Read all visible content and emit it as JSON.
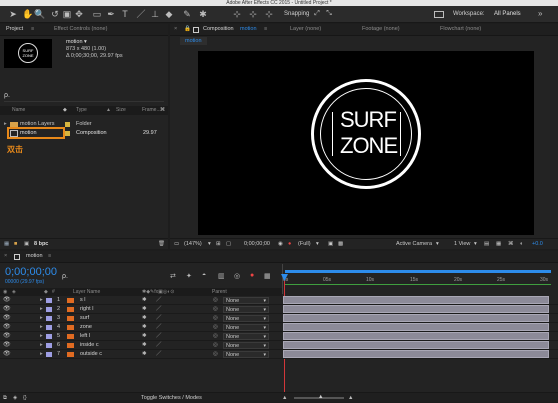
{
  "window": {
    "title": "Adobe After Effects CC 2015 - Untitled Project *"
  },
  "toolbar": {
    "snapping_label": "Snapping",
    "workspace_label": "Workspace:",
    "workspace_value": "All Panels"
  },
  "project_panel": {
    "tab_project": "Project",
    "tab_effects": "Effect Controls (none)",
    "thumbnail_text_line1": "SURF",
    "thumbnail_text_line2": "ZONE",
    "item_name": "motion ▾",
    "item_dims": "873 x 480 (1.00)",
    "item_duration": "Δ 0;00;30;00, 29.97 fps",
    "search_placeholder": "ρ.",
    "col_name": "Name",
    "col_type": "Type",
    "col_size": "Size",
    "col_frame": "Frame...",
    "rows": [
      {
        "name": "motion Layers",
        "type": "Folder",
        "size": "",
        "frame": ""
      },
      {
        "name": "motion",
        "type": "Composition",
        "size": "",
        "frame": "29.97"
      }
    ],
    "annotation": "双击",
    "bpc": "8 bpc"
  },
  "composition_panel": {
    "tab_composition": "Composition",
    "tab_comp_name": "motion",
    "tab_layer": "Layer (none)",
    "tab_footage": "Footage (none)",
    "tab_flowchart": "Flowchart (none)",
    "breadcrumb": "motion",
    "logo_line1": "SURF",
    "logo_line2": "ZONE",
    "zoom": "(147%)",
    "timecode": "0;00;00;00",
    "resolution": "(Full)",
    "camera": "Active Camera",
    "view": "1 View",
    "offset": "+0.0"
  },
  "timeline": {
    "comp_tab": "motion",
    "timecode": "0;00;00;00",
    "frame_info": "00000 (29.97 fps)",
    "search_placeholder": "ρ.",
    "col_layer_name": "Layer Name",
    "col_parent": "Parent",
    "ruler_labels": [
      "0s",
      "05s",
      "10s",
      "15s",
      "20s",
      "25s",
      "30s"
    ],
    "layers": [
      {
        "num": "1",
        "name": "s l",
        "parent": "None"
      },
      {
        "num": "2",
        "name": "right l",
        "parent": "None"
      },
      {
        "num": "3",
        "name": "surf",
        "parent": "None"
      },
      {
        "num": "4",
        "name": "zone",
        "parent": "None"
      },
      {
        "num": "5",
        "name": "left l",
        "parent": "None"
      },
      {
        "num": "6",
        "name": "inside c",
        "parent": "None"
      },
      {
        "num": "7",
        "name": "outside c",
        "parent": "None"
      }
    ],
    "footer_label": "Toggle Switches / Modes"
  },
  "colors": {
    "accent": "#2d8ceb",
    "annotation_orange": "#e8891a",
    "layer_bar": "#8c8a98",
    "layer_label": "#9e9ee3"
  }
}
